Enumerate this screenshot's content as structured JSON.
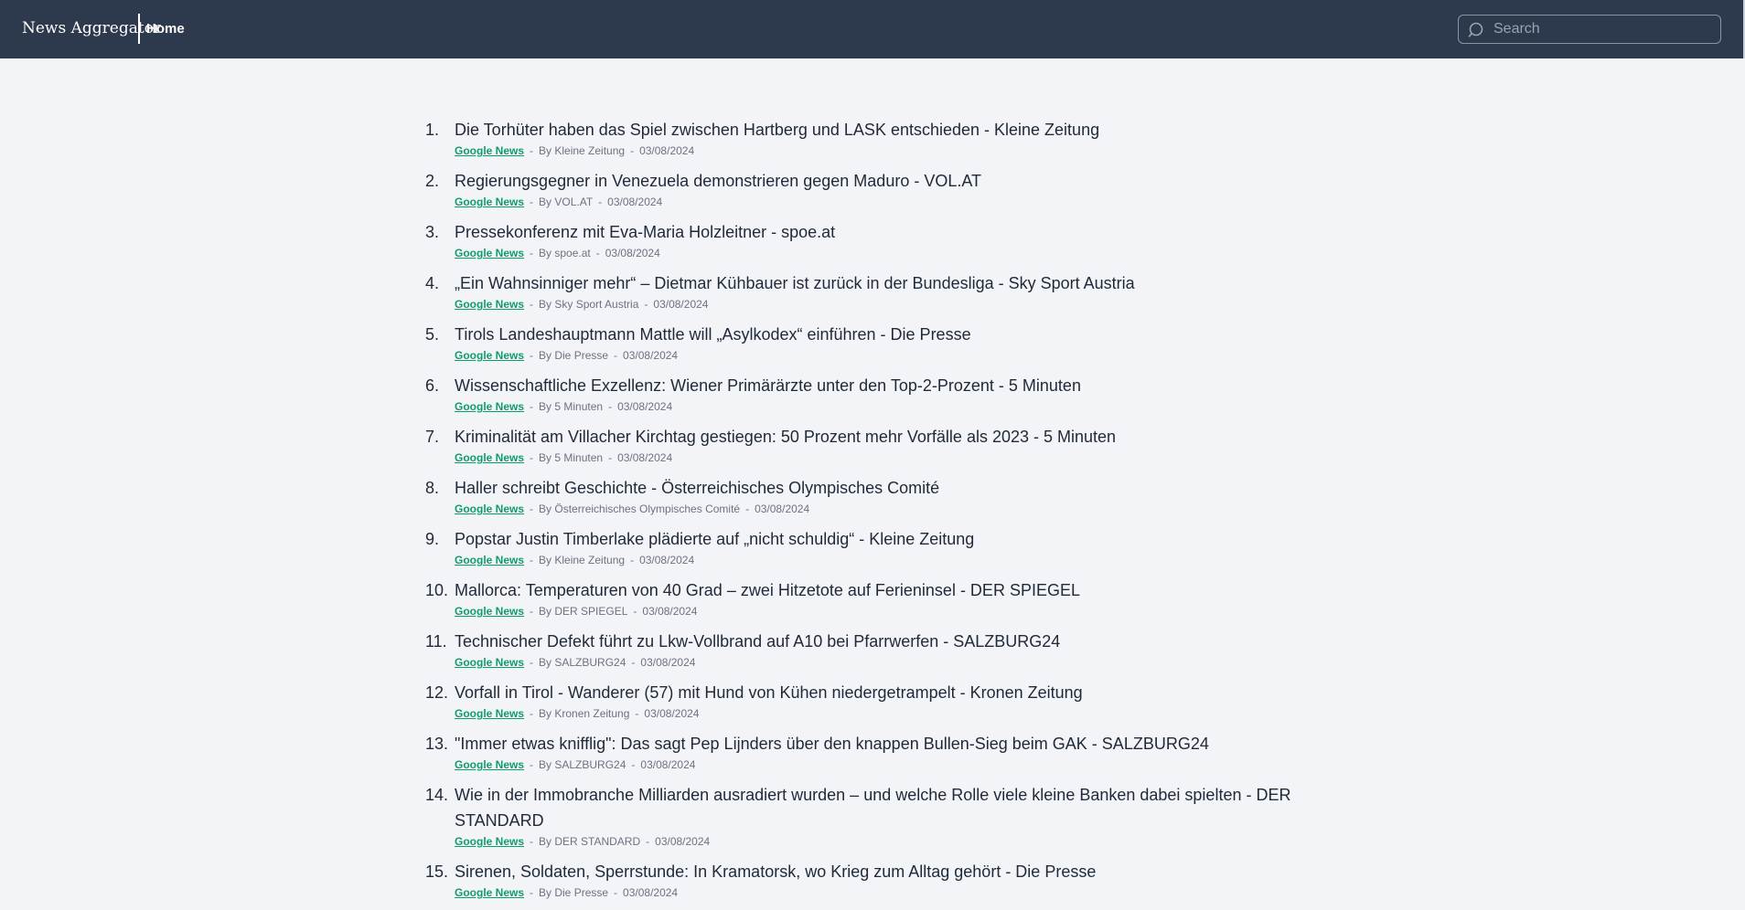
{
  "header": {
    "brand": "News Aggregator",
    "nav_home": "Home",
    "search_placeholder": "Search"
  },
  "colors": {
    "navbar": "#2d3a4d",
    "background": "#f2f4f8",
    "source": "#0f9d6b",
    "meta": "#6b7280"
  },
  "articles": [
    {
      "num": "1.",
      "title": "Die Torhüter haben das Spiel zwischen Hartberg und LASK entschieden - Kleine Zeitung",
      "source": "Google News",
      "author": "By Kleine Zeitung",
      "date": "03/08/2024"
    },
    {
      "num": "2.",
      "title": "Regierungsgegner in Venezuela demonstrieren gegen Maduro - VOL.AT",
      "source": "Google News",
      "author": "By VOL.AT",
      "date": "03/08/2024"
    },
    {
      "num": "3.",
      "title": "Pressekonferenz mit Eva-Maria Holzleitner - spoe.at",
      "source": "Google News",
      "author": "By spoe.at",
      "date": "03/08/2024"
    },
    {
      "num": "4.",
      "title": "„Ein Wahnsinniger mehr“ – Dietmar Kühbauer ist zurück in der Bundesliga - Sky Sport Austria",
      "source": "Google News",
      "author": "By Sky Sport Austria",
      "date": "03/08/2024"
    },
    {
      "num": "5.",
      "title": "Tirols Landeshauptmann Mattle will „Asylkodex“ einführen - Die Presse",
      "source": "Google News",
      "author": "By Die Presse",
      "date": "03/08/2024"
    },
    {
      "num": "6.",
      "title": "Wissenschaftliche Exzellenz: Wiener Primärärzte unter den Top-2-Prozent - 5 Minuten",
      "source": "Google News",
      "author": "By 5 Minuten",
      "date": "03/08/2024"
    },
    {
      "num": "7.",
      "title": "Kriminalität am Villacher Kirchtag gestiegen: 50 Prozent mehr Vorfälle als 2023 - 5 Minuten",
      "source": "Google News",
      "author": "By 5 Minuten",
      "date": "03/08/2024"
    },
    {
      "num": "8.",
      "title": "Haller schreibt Geschichte - Österreichisches Olympisches Comité",
      "source": "Google News",
      "author": "By Österreichisches Olympisches Comité",
      "date": "03/08/2024"
    },
    {
      "num": "9.",
      "title": "Popstar Justin Timberlake plädierte auf „nicht schuldig“ - Kleine Zeitung",
      "source": "Google News",
      "author": "By Kleine Zeitung",
      "date": "03/08/2024"
    },
    {
      "num": "10.",
      "title": "Mallorca: Temperaturen von 40 Grad – zwei Hitzetote auf Ferieninsel - DER SPIEGEL",
      "source": "Google News",
      "author": "By DER SPIEGEL",
      "date": "03/08/2024"
    },
    {
      "num": "11.",
      "title": "Technischer Defekt führt zu Lkw-Vollbrand auf A10 bei Pfarrwerfen - SALZBURG24",
      "source": "Google News",
      "author": "By SALZBURG24",
      "date": "03/08/2024"
    },
    {
      "num": "12.",
      "title": "Vorfall in Tirol - Wanderer (57) mit Hund von Kühen niedergetrampelt - Kronen Zeitung",
      "source": "Google News",
      "author": "By Kronen Zeitung",
      "date": "03/08/2024"
    },
    {
      "num": "13.",
      "title": "\"Immer etwas knifflig\": Das sagt Pep Lijnders über den knappen Bullen-Sieg beim GAK - SALZBURG24",
      "source": "Google News",
      "author": "By SALZBURG24",
      "date": "03/08/2024"
    },
    {
      "num": "14.",
      "title": "Wie in der Immobranche Milliarden ausradiert wurden – und welche Rolle viele kleine Banken dabei spielten - DER STANDARD",
      "source": "Google News",
      "author": "By DER STANDARD",
      "date": "03/08/2024"
    },
    {
      "num": "15.",
      "title": "Sirenen, Soldaten, Sperrstunde: In Kramatorsk, wo Krieg zum Alltag gehört - Die Presse",
      "source": "Google News",
      "author": "By Die Presse",
      "date": "03/08/2024"
    }
  ]
}
